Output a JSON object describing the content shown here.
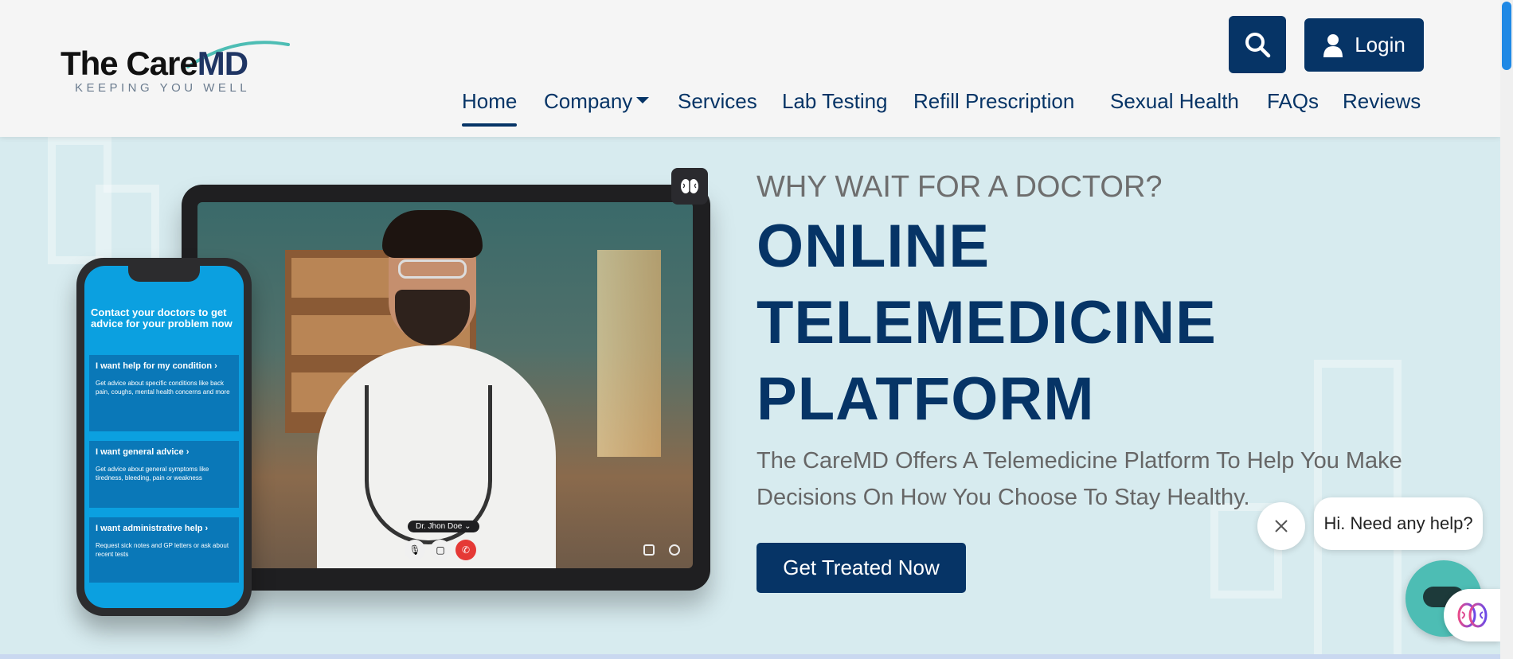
{
  "brand": {
    "name_main": "The Care",
    "name_accent": "MD",
    "tagline": "KEEPING YOU WELL",
    "primary_color": "#063466",
    "accent_color": "#4dbdb4"
  },
  "header": {
    "search_icon": "search-icon",
    "login_label": "Login",
    "nav": [
      {
        "label": "Home",
        "active": true
      },
      {
        "label": "Company",
        "dropdown": true
      },
      {
        "label": "Services"
      },
      {
        "label": "Lab Testing"
      },
      {
        "label": "Refill Prescription"
      },
      {
        "label": "Sexual Health"
      },
      {
        "label": "FAQs"
      },
      {
        "label": "Reviews"
      }
    ]
  },
  "hero": {
    "eyebrow": "WHY WAIT FOR A DOCTOR?",
    "headline": [
      "ONLINE",
      "TELEMEDICINE",
      "PLATFORM"
    ],
    "description": "The CareMD Offers A Telemedicine Platform To Help You Make Decisions On How You Choose To Stay Healthy.",
    "cta_label": "Get Treated Now",
    "background_color": "#d7ebef"
  },
  "phone_mockup": {
    "title": "Contact your doctors to get advice for your problem now",
    "cards": [
      {
        "title": "I want help for my condition  ›",
        "desc": "Get advice about specific conditions like back pain, coughs, mental health concerns and more"
      },
      {
        "title": "I want general advice  ›",
        "desc": "Get advice about general symptoms like tiredness, bleeding, pain or weakness"
      },
      {
        "title": "I want administrative help  ›",
        "desc": "Request sick notes and GP letters or ask about recent tests"
      }
    ]
  },
  "video_call": {
    "doctor_name": "Dr. Jhon Doe ⌄"
  },
  "chat": {
    "greeting": "Hi. Need any help?",
    "close_icon": "close-icon"
  }
}
